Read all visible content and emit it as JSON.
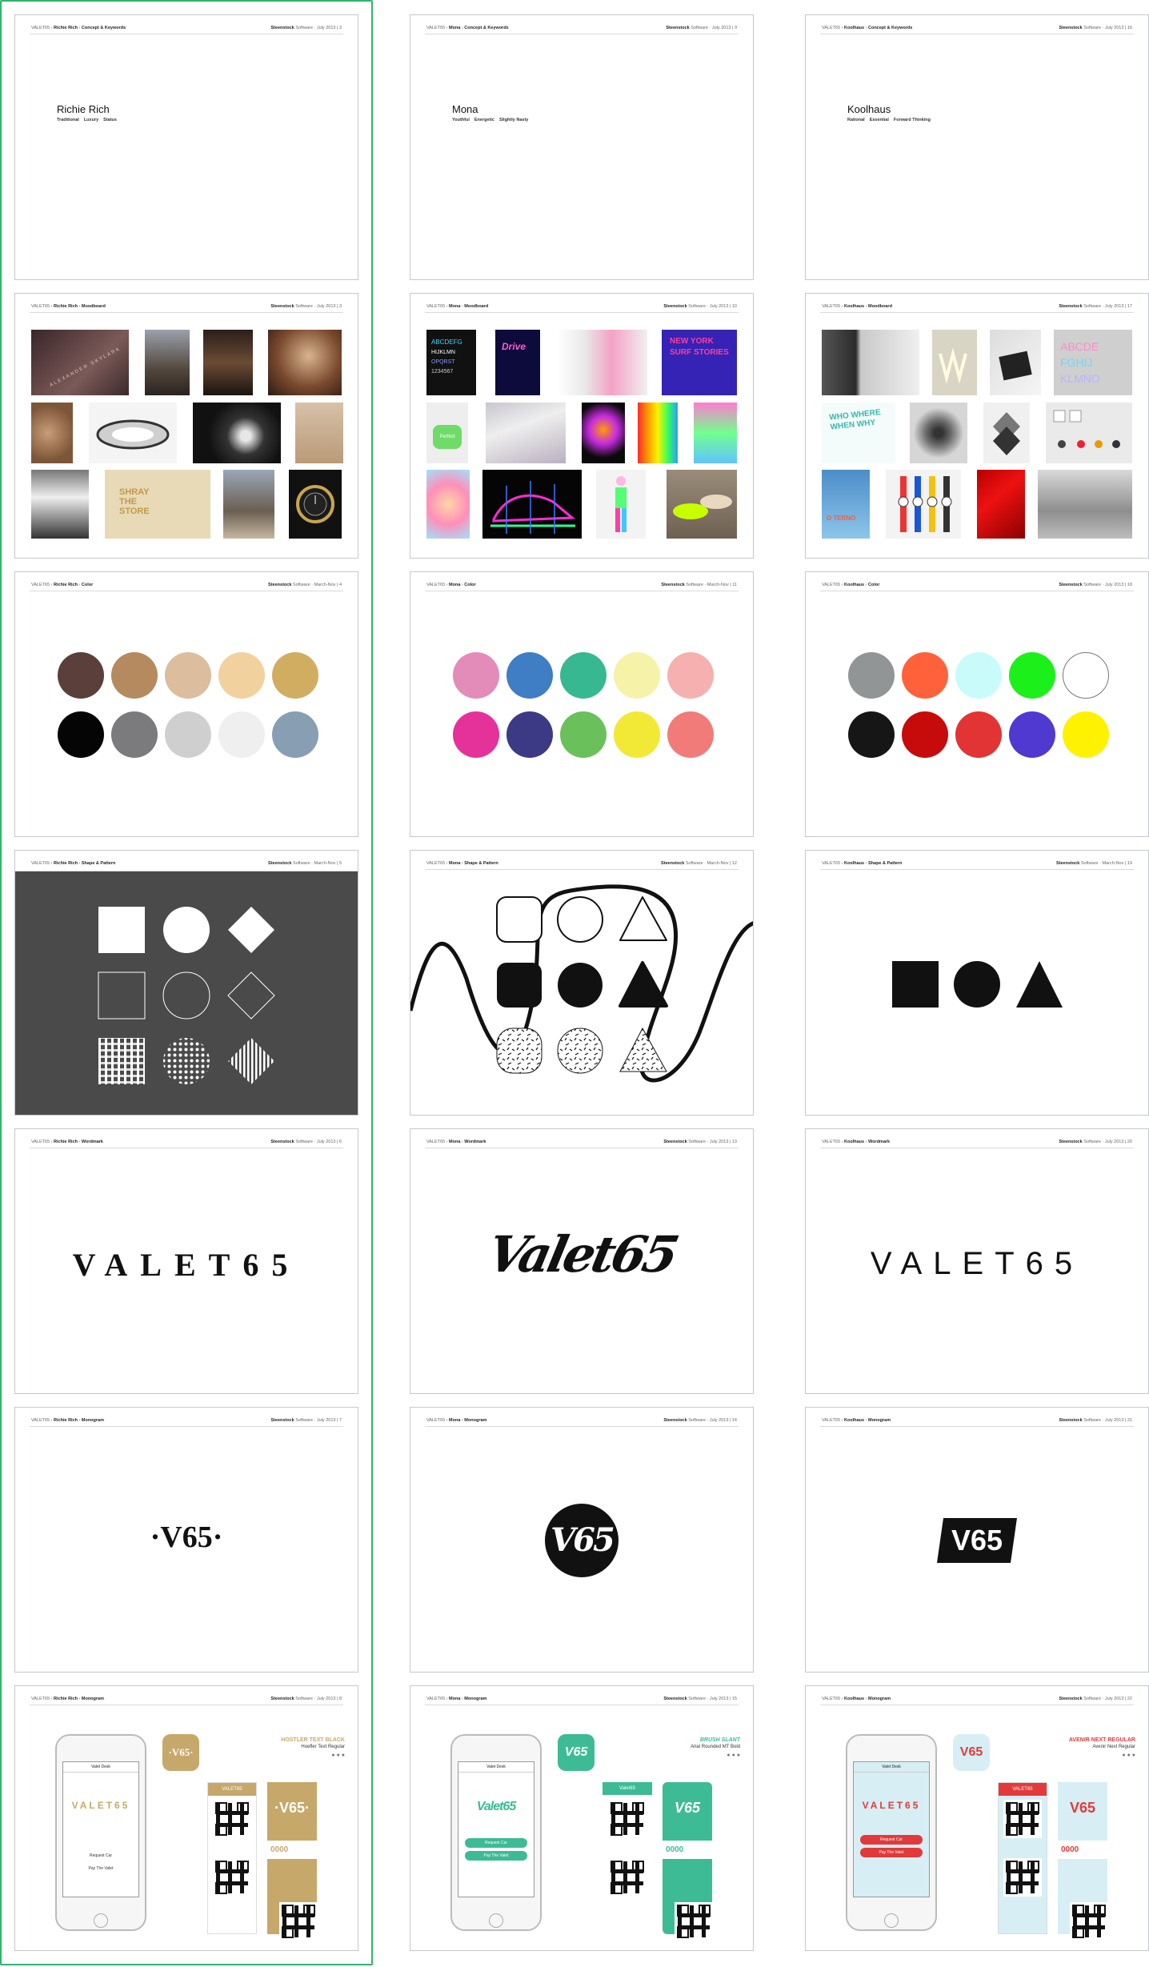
{
  "headers": [
    [
      "Richie Rich",
      "Concept & Keywords",
      "Steenstock",
      "Software",
      "July 2013",
      "3"
    ],
    [
      "Mona",
      "Concept & Keywords",
      "Steenstock",
      "Software",
      "July 2013",
      "9"
    ],
    [
      "Koolhaus",
      "Concept & Keywords",
      "Steenstock",
      "Software",
      "July 2013",
      "16"
    ],
    [
      "Richie Rich",
      "Moodboard",
      "Steenstock",
      "Software",
      "July 2013",
      "3"
    ],
    [
      "Mona",
      "Moodboard",
      "Steenstock",
      "Software",
      "July 2013",
      "10"
    ],
    [
      "Koolhaus",
      "Moodboard",
      "Steenstock",
      "Software",
      "July 2013",
      "17"
    ],
    [
      "Richie Rich",
      "Color",
      "Steenstock",
      "Software",
      "March-Nov",
      "4"
    ],
    [
      "Mona",
      "Color",
      "Steenstock",
      "Software",
      "March-Nov",
      "11"
    ],
    [
      "Koolhaus",
      "Color",
      "Steenstock",
      "Software",
      "July 2013",
      "18"
    ],
    [
      "Richie Rich",
      "Shape & Pattern",
      "Steenstock",
      "Software",
      "March-Nov",
      "5"
    ],
    [
      "Mona",
      "Shape & Pattern",
      "Steenstock",
      "Software",
      "March-Nov",
      "12"
    ],
    [
      "Koolhaus",
      "Shape & Pattern",
      "Steenstock",
      "Software",
      "March-Nov",
      "19"
    ],
    [
      "Richie Rich",
      "Wordmark",
      "Steenstock",
      "Software",
      "July 2013",
      "6"
    ],
    [
      "Mona",
      "Wordmark",
      "Steenstock",
      "Software",
      "July 2013",
      "13"
    ],
    [
      "Koolhaus",
      "Wordmark",
      "Steenstock",
      "Software",
      "July 2013",
      "20"
    ],
    [
      "Richie Rich",
      "Monogram",
      "Steenstock",
      "Software",
      "July 2013",
      "7"
    ],
    [
      "Mona",
      "Monogram",
      "Steenstock",
      "Software",
      "July 2013",
      "14"
    ],
    [
      "Koolhaus",
      "Monogram",
      "Steenstock",
      "Software",
      "July 2013",
      "21"
    ],
    [
      "Richie Rich",
      "Monogram",
      "Steenstock",
      "Software",
      "July 2013",
      "8"
    ],
    [
      "Mona",
      "Monogram",
      "Steenstock",
      "Software",
      "July 2013",
      "15"
    ],
    [
      "Koolhaus",
      "Monogram",
      "Steenstock",
      "Software",
      "July 2013",
      "22"
    ]
  ],
  "header_prefix": "VALET65",
  "concepts": [
    {
      "title": "Richie Rich",
      "keywords": [
        "Traditional",
        "Luxury",
        "Status"
      ]
    },
    {
      "title": "Mona",
      "keywords": [
        "Youthful",
        "Energetic",
        "Slightly Nasty"
      ]
    },
    {
      "title": "Koolhaus",
      "keywords": [
        "Rational",
        "Essential",
        "Forward Thinking"
      ]
    }
  ],
  "moodboard_text": {
    "richie_card": "ALEXANDER SKYLARK",
    "richie_box": "SHRAY THE STORE",
    "mona_poster1": "Drive",
    "mona_poster2": "NEW YORK SURF STORIES",
    "mona_bag": "Perfect",
    "koolhaus_poster": "WHO WHERE WHEN WHY",
    "koolhaus_blue": "O TERNO"
  },
  "palettes": [
    [
      "#5a3f3a",
      "#b58a5f",
      "#dcbd9d",
      "#f1d29e",
      "#d1ad62",
      "#050505",
      "#7b7b7d",
      "#cfcfcf",
      "#efefef",
      "#879eb3"
    ],
    [
      "#e38bb9",
      "#3f7dc4",
      "#38b891",
      "#f6f2a8",
      "#f6b0b0",
      "#e4329a",
      "#3c3a84",
      "#6ac05b",
      "#f1e936",
      "#f17b78"
    ],
    [
      "#929596",
      "#ff623a",
      "#c9fbfa",
      "#1cf01a",
      "#ffffff",
      "#161616",
      "#c70a0a",
      "#e23434",
      "#4f39d1",
      "#fff200"
    ]
  ],
  "wordmarks": [
    "VALET65",
    "Valet65",
    "VALET65"
  ],
  "monograms": [
    "·V65·",
    "V65",
    "V65"
  ],
  "mockups": [
    {
      "type_heading": "HOSTLER TEXT BLACK",
      "type_sub": "Hoefler Text Regular",
      "card": "VALET65",
      "code": "0000",
      "btn1": "Request Car",
      "btn2": "Pay The Valet",
      "app_title": "Valet Desk"
    },
    {
      "type_heading": "BRUSH SLANT",
      "type_sub": "Arial Rounded MT Bold",
      "card": "Valet65",
      "code": "0000",
      "btn1": "Request Car",
      "btn2": "Pay The Valet",
      "app_title": "Valet Desk"
    },
    {
      "type_heading": "AVENIR NEXT REGULAR",
      "type_sub": "Avenir Next Regular",
      "card": "VALET65",
      "code": "0000",
      "btn1": "Request Car",
      "btn2": "Pay The Valet",
      "app_title": "Valet Desk"
    }
  ]
}
